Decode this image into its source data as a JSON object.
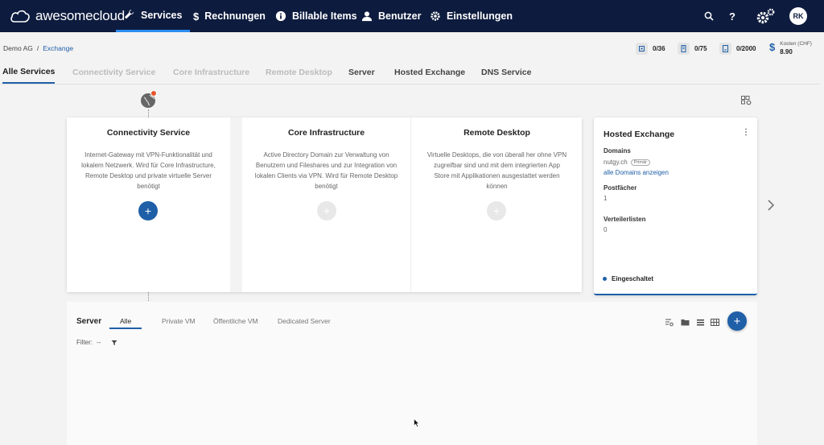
{
  "app": {
    "logo_text": "awesomecloud"
  },
  "nav": {
    "items": [
      {
        "label": "Services",
        "icon": "wrench-icon",
        "active": true
      },
      {
        "label": "Rechnungen",
        "icon": "dollar-icon"
      },
      {
        "label": "Billable Items",
        "icon": "info-icon"
      },
      {
        "label": "Benutzer",
        "icon": "user-icon"
      },
      {
        "label": "Einstellungen",
        "icon": "gear-icon"
      }
    ],
    "help_label": "?",
    "avatar_initials": "RK"
  },
  "breadcrumb": {
    "root": "Demo AG",
    "separator": "/",
    "current": "Exchange"
  },
  "stats": [
    {
      "icon": "cpu-icon",
      "value": "0/36"
    },
    {
      "icon": "memory-icon",
      "value": "0/75"
    },
    {
      "icon": "storage-icon",
      "value": "0/2000"
    }
  ],
  "costs": {
    "symbol": "$",
    "label": "Kosten (CHF)",
    "value": "8.90"
  },
  "tabs": [
    {
      "label": "Alle Services",
      "state": "active"
    },
    {
      "label": "Connectivity Service",
      "state": "disabled"
    },
    {
      "label": "Core Infrastructure",
      "state": "disabled"
    },
    {
      "label": "Remote Desktop",
      "state": "disabled"
    },
    {
      "label": "Server",
      "state": "enabled"
    },
    {
      "label": "Hosted Exchange",
      "state": "enabled"
    },
    {
      "label": "DNS Service",
      "state": "enabled"
    }
  ],
  "cards": [
    {
      "title": "Connectivity Service",
      "description": "Internet-Gateway mit VPN-Funktionalität und lokalem Netzwerk. Wird für Core Infrastructure, Remote Desktop und private virtuelle Server benötigt",
      "add_enabled": true
    },
    {
      "title": "Core Infrastructure",
      "description": "Active Directory Domain zur Verwaltung von Benutzern und Fileshares und zur Integration von lokalen Clients via VPN. Wird für Remote Desktop benötigt",
      "add_enabled": false
    },
    {
      "title": "Remote Desktop",
      "description": "Virtuelle Desktops, die von überall her ohne VPN zugreifbar sind und mit dem integrierten App Store mit Applikationen ausgestattet werden können",
      "add_enabled": false
    }
  ],
  "exchange": {
    "title": "Hosted Exchange",
    "domains_label": "Domains",
    "domain": "nutgy.ch",
    "domain_badge": "Primär",
    "domains_link": "alle Domains anzeigen",
    "mailboxes_label": "Postfächer",
    "mailboxes_value": "1",
    "lists_label": "Verteilerlisten",
    "lists_value": "0",
    "status": "Eingeschaltet"
  },
  "server": {
    "title": "Server",
    "tabs": [
      "Alle",
      "Private VM",
      "Öffentliche VM",
      "Dedicated Server"
    ],
    "filter_label": "Filter:",
    "filter_value": "--",
    "add_label": "+"
  },
  "plus_label": "+",
  "colors": {
    "nav_bg": "#0d1b3e",
    "accent": "#1f5fa8",
    "badge": "#e8542c"
  }
}
